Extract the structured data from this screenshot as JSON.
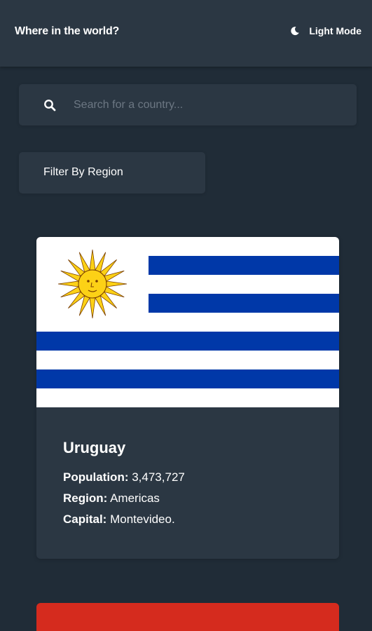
{
  "header": {
    "title": "Where in the world?",
    "theme_toggle_label": "Light Mode",
    "theme_icon": "moon-icon"
  },
  "search": {
    "placeholder": "Search for a country...",
    "value": "",
    "icon": "search-icon"
  },
  "filter": {
    "label": "Filter By Region"
  },
  "countries": [
    {
      "name": "Uruguay",
      "population_label": "Population:",
      "population": "3,473,727",
      "region_label": "Region:",
      "region": "Americas",
      "capital_label": "Capital:",
      "capital": "Montevideo."
    }
  ],
  "colors": {
    "background": "#202c37",
    "surface": "#2b3743",
    "text": "#ffffff",
    "placeholder": "#6c7783",
    "uruguay_blue": "#0038a8",
    "next_card_flag": "#d52b1e"
  }
}
